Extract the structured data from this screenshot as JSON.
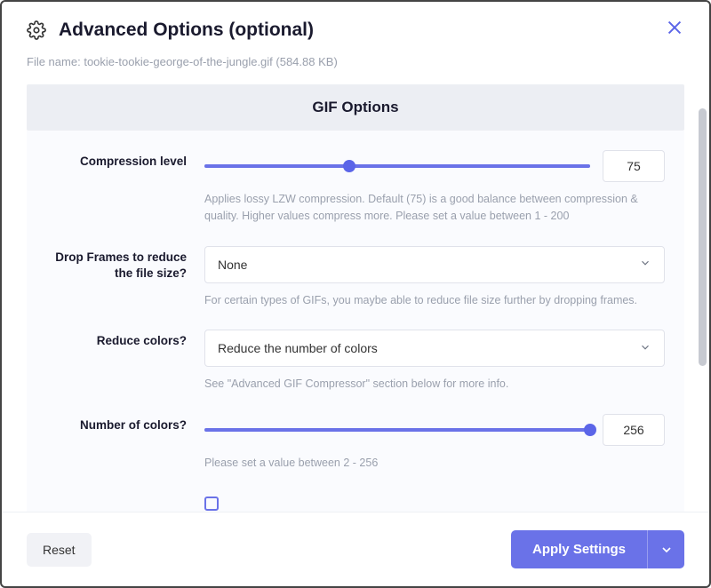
{
  "modal": {
    "title": "Advanced Options (optional)",
    "fileLabel": "File name:",
    "fileValue": "tookie-tookie-george-of-the-jungle.gif (584.88 KB)",
    "sectionTitle": "GIF Options"
  },
  "compression": {
    "label": "Compression level",
    "value": "75",
    "percent": 37.5,
    "fillPercent": 100,
    "help": "Applies lossy LZW compression. Default (75) is a good balance between compression & quality. Higher values compress more. Please set a value between 1 - 200"
  },
  "dropFrames": {
    "label": "Drop Frames to reduce the file size?",
    "selected": "None",
    "help": "For certain types of GIFs, you maybe able to reduce file size further by dropping frames."
  },
  "reduceColors": {
    "label": "Reduce colors?",
    "selected": "Reduce the number of colors",
    "help": "See \"Advanced GIF Compressor\" section below for more info."
  },
  "numColors": {
    "label": "Number of colors?",
    "value": "256",
    "percent": 100,
    "fillPercent": 100,
    "help": "Please set a value between 2 - 256"
  },
  "footer": {
    "reset": "Reset",
    "apply": "Apply Settings"
  }
}
